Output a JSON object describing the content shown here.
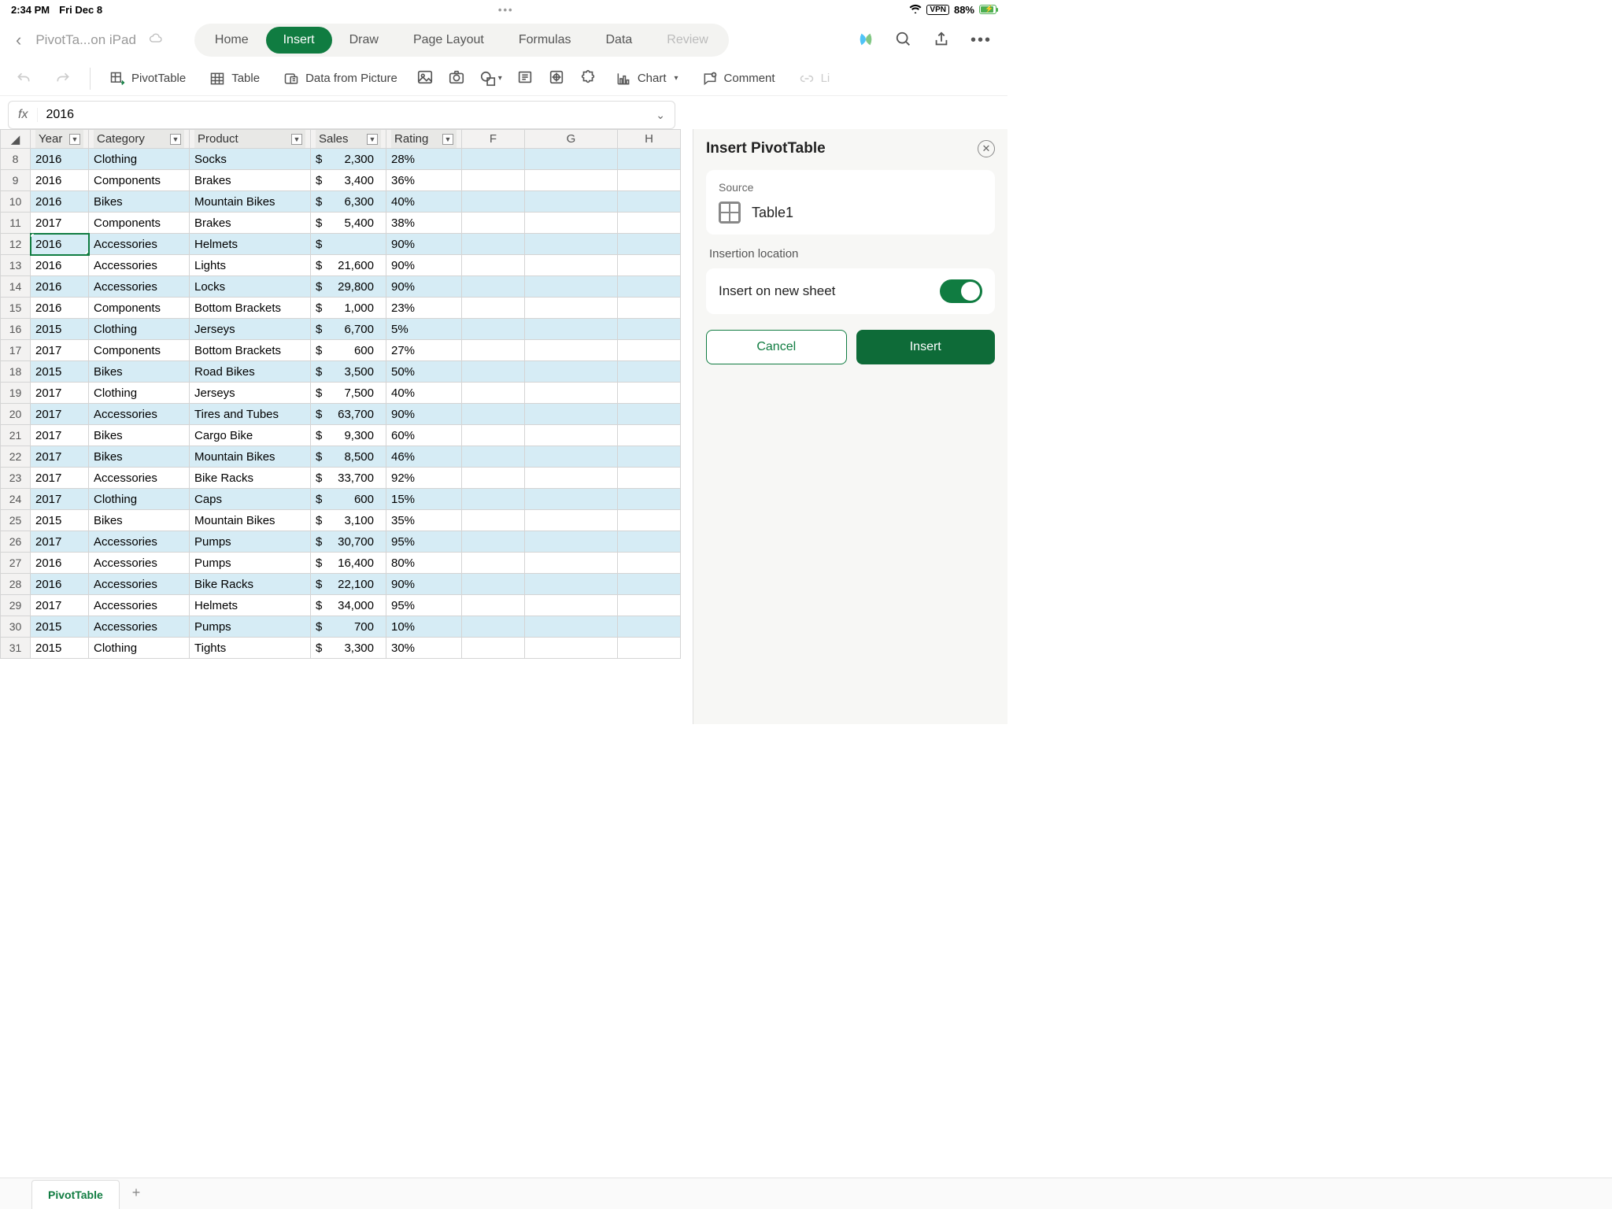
{
  "status": {
    "time": "2:34 PM",
    "date": "Fri Dec 8",
    "vpn": "VPN",
    "battery": "88%"
  },
  "title": {
    "doc": "PivotTa...on iPad"
  },
  "tabs": {
    "home": "Home",
    "insert": "Insert",
    "draw": "Draw",
    "pagelayout": "Page Layout",
    "formulas": "Formulas",
    "data": "Data",
    "review": "Review"
  },
  "ribbon": {
    "pivottable": "PivotTable",
    "table": "Table",
    "datafrompic": "Data from Picture",
    "chart": "Chart",
    "comment": "Comment",
    "link": "Li"
  },
  "formula": {
    "fx": "fx",
    "value": "2016"
  },
  "columns": {
    "A": "Year",
    "B": "Category",
    "C": "Product",
    "D": "Sales",
    "E": "Rating",
    "F": "F",
    "G": "G",
    "H": "H"
  },
  "rows": [
    {
      "n": 8,
      "year": "2016",
      "cat": "Clothing",
      "prod": "Socks",
      "sales": "2,300",
      "rating": "28%"
    },
    {
      "n": 9,
      "year": "2016",
      "cat": "Components",
      "prod": "Brakes",
      "sales": "3,400",
      "rating": "36%"
    },
    {
      "n": 10,
      "year": "2016",
      "cat": "Bikes",
      "prod": "Mountain Bikes",
      "sales": "6,300",
      "rating": "40%"
    },
    {
      "n": 11,
      "year": "2017",
      "cat": "Components",
      "prod": "Brakes",
      "sales": "5,400",
      "rating": "38%"
    },
    {
      "n": 12,
      "year": "2016",
      "cat": "Accessories",
      "prod": "Helmets",
      "sales": "",
      "rating": "90%"
    },
    {
      "n": 13,
      "year": "2016",
      "cat": "Accessories",
      "prod": "Lights",
      "sales": "21,600",
      "rating": "90%"
    },
    {
      "n": 14,
      "year": "2016",
      "cat": "Accessories",
      "prod": "Locks",
      "sales": "29,800",
      "rating": "90%"
    },
    {
      "n": 15,
      "year": "2016",
      "cat": "Components",
      "prod": "Bottom Brackets",
      "sales": "1,000",
      "rating": "23%"
    },
    {
      "n": 16,
      "year": "2015",
      "cat": "Clothing",
      "prod": "Jerseys",
      "sales": "6,700",
      "rating": "5%"
    },
    {
      "n": 17,
      "year": "2017",
      "cat": "Components",
      "prod": "Bottom Brackets",
      "sales": "600",
      "rating": "27%"
    },
    {
      "n": 18,
      "year": "2015",
      "cat": "Bikes",
      "prod": "Road Bikes",
      "sales": "3,500",
      "rating": "50%"
    },
    {
      "n": 19,
      "year": "2017",
      "cat": "Clothing",
      "prod": "Jerseys",
      "sales": "7,500",
      "rating": "40%"
    },
    {
      "n": 20,
      "year": "2017",
      "cat": "Accessories",
      "prod": "Tires and Tubes",
      "sales": "63,700",
      "rating": "90%"
    },
    {
      "n": 21,
      "year": "2017",
      "cat": "Bikes",
      "prod": "Cargo Bike",
      "sales": "9,300",
      "rating": "60%"
    },
    {
      "n": 22,
      "year": "2017",
      "cat": "Bikes",
      "prod": "Mountain Bikes",
      "sales": "8,500",
      "rating": "46%"
    },
    {
      "n": 23,
      "year": "2017",
      "cat": "Accessories",
      "prod": "Bike Racks",
      "sales": "33,700",
      "rating": "92%"
    },
    {
      "n": 24,
      "year": "2017",
      "cat": "Clothing",
      "prod": "Caps",
      "sales": "600",
      "rating": "15%"
    },
    {
      "n": 25,
      "year": "2015",
      "cat": "Bikes",
      "prod": "Mountain Bikes",
      "sales": "3,100",
      "rating": "35%"
    },
    {
      "n": 26,
      "year": "2017",
      "cat": "Accessories",
      "prod": "Pumps",
      "sales": "30,700",
      "rating": "95%"
    },
    {
      "n": 27,
      "year": "2016",
      "cat": "Accessories",
      "prod": "Pumps",
      "sales": "16,400",
      "rating": "80%"
    },
    {
      "n": 28,
      "year": "2016",
      "cat": "Accessories",
      "prod": "Bike Racks",
      "sales": "22,100",
      "rating": "90%"
    },
    {
      "n": 29,
      "year": "2017",
      "cat": "Accessories",
      "prod": "Helmets",
      "sales": "34,000",
      "rating": "95%"
    },
    {
      "n": 30,
      "year": "2015",
      "cat": "Accessories",
      "prod": "Pumps",
      "sales": "700",
      "rating": "10%"
    },
    {
      "n": 31,
      "year": "2015",
      "cat": "Clothing",
      "prod": "Tights",
      "sales": "3,300",
      "rating": "30%"
    }
  ],
  "panel": {
    "title": "Insert PivotTable",
    "source_label": "Source",
    "source_name": "Table1",
    "location_label": "Insertion location",
    "toggle_label": "Insert on new sheet",
    "cancel": "Cancel",
    "insert": "Insert"
  },
  "sheettab": {
    "name": "PivotTable"
  }
}
